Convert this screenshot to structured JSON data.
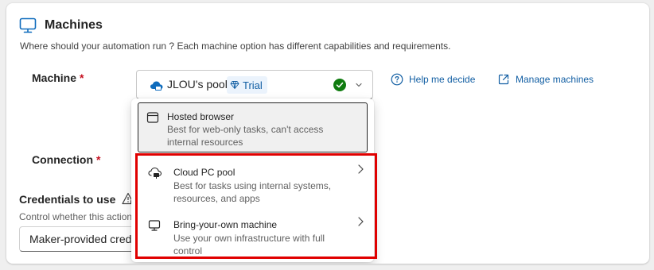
{
  "section": {
    "title": "Machines",
    "description": "Where should your automation run ? Each machine option has different capabilities and requirements."
  },
  "machine_field": {
    "label": "Machine",
    "required_marker": "*",
    "selected_value": "JLOU's pool",
    "badge": "Trial",
    "status": "connected"
  },
  "links": {
    "help": "Help me decide",
    "manage": "Manage machines"
  },
  "connection_field": {
    "label": "Connection",
    "required_marker": "*"
  },
  "credentials": {
    "title": "Credentials to use",
    "description": "Control whether this action",
    "selected_value": "Maker-provided crede"
  },
  "dropdown": {
    "options": [
      {
        "title": "Hosted browser",
        "description": "Best for web-only tasks, can't access internal resources",
        "icon": "browser-window-icon",
        "has_submenu": false,
        "focused": true
      },
      {
        "title": "Cloud PC pool",
        "description": "Best for tasks using internal systems, resources, and apps",
        "icon": "cloud-pc-icon",
        "has_submenu": true,
        "focused": false
      },
      {
        "title": "Bring-your-own machine",
        "description": "Use your own infrastructure with full control",
        "icon": "desktop-icon",
        "has_submenu": true,
        "focused": false
      }
    ]
  },
  "colors": {
    "link": "#115ea3",
    "required": "#c50f1f",
    "success": "#107c10",
    "highlight": "#e00000",
    "badge_bg": "#ebf3fc"
  }
}
